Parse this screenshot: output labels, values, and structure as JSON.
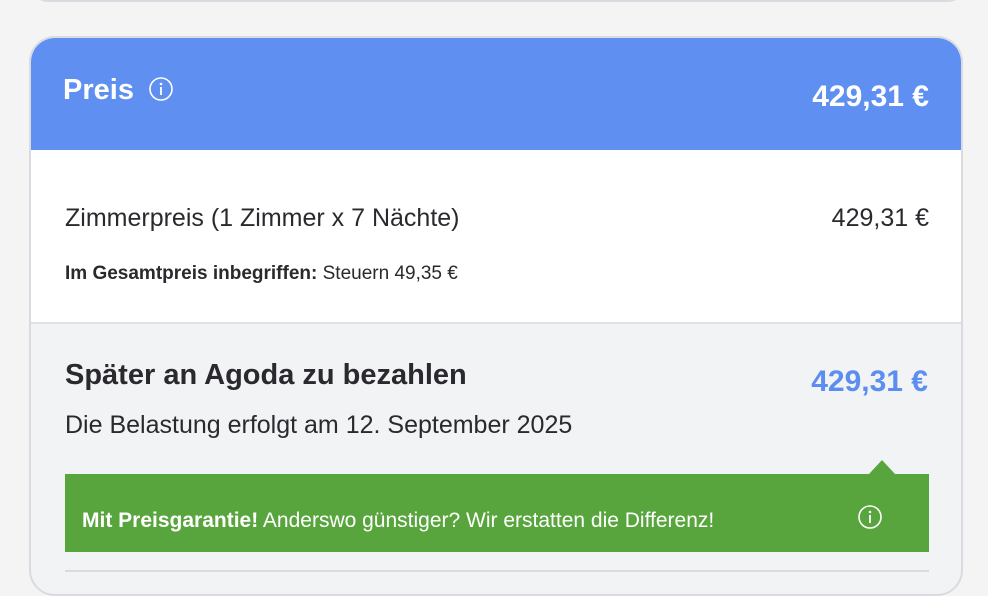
{
  "header": {
    "title": "Preis",
    "total": "429,31 €"
  },
  "room": {
    "label": "Zimmerpreis (1 Zimmer x 7 Nächte)",
    "price": "429,31 €",
    "included_label": "Im Gesamtpreis inbegriffen:",
    "included_value": "Steuern 49,35 €"
  },
  "payment": {
    "title": "Später an Agoda zu bezahlen",
    "amount": "429,31 €",
    "charge_note": "Die Belastung erfolgt am 12. September 2025"
  },
  "guarantee": {
    "bold": "Mit Preisgarantie!",
    "text": "Anderswo günstiger? Wir erstatten die Differenz!"
  },
  "icons": {
    "header_info": "info-icon",
    "guarantee_info": "info-icon"
  },
  "colors": {
    "header_bg": "#5f90f1",
    "amount_blue": "#5b8ef0",
    "guarantee_green": "#58a53d"
  }
}
